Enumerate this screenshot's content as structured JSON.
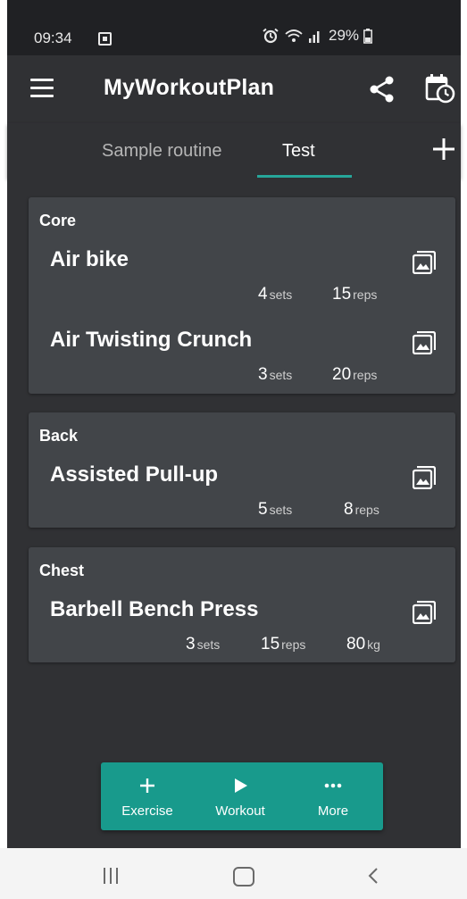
{
  "status_bar": {
    "time": "09:34",
    "battery": "29%"
  },
  "app_bar": {
    "title": "MyWorkoutPlan"
  },
  "tabs": [
    {
      "label": "Sample routine",
      "selected": false
    },
    {
      "label": "Test",
      "selected": true
    }
  ],
  "groups": [
    {
      "name": "Core",
      "exercises": [
        {
          "name": "Air bike",
          "sets": "4",
          "reps": "15"
        },
        {
          "name": "Air Twisting Crunch",
          "sets": "3",
          "reps": "20"
        }
      ]
    },
    {
      "name": "Back",
      "exercises": [
        {
          "name": "Assisted Pull-up",
          "sets": "5",
          "reps": "8"
        }
      ]
    },
    {
      "name": "Chest",
      "exercises": [
        {
          "name": "Barbell Bench Press",
          "sets": "3",
          "reps": "15",
          "weight": "80"
        }
      ]
    }
  ],
  "units": {
    "sets": "sets",
    "reps": "reps",
    "weight": "kg"
  },
  "fab": {
    "exercise_label": "Exercise",
    "workout_label": "Workout",
    "more_label": "More"
  },
  "colors": {
    "accent": "#26a69a",
    "fab": "#189a8c",
    "background": "#303134",
    "card": "#424549"
  },
  "icons": {
    "menu": "hamburger-menu-icon",
    "share": "share-icon",
    "calendar": "calendar-clock-icon",
    "add_tab": "plus-icon",
    "exercise_image": "image-icon"
  }
}
